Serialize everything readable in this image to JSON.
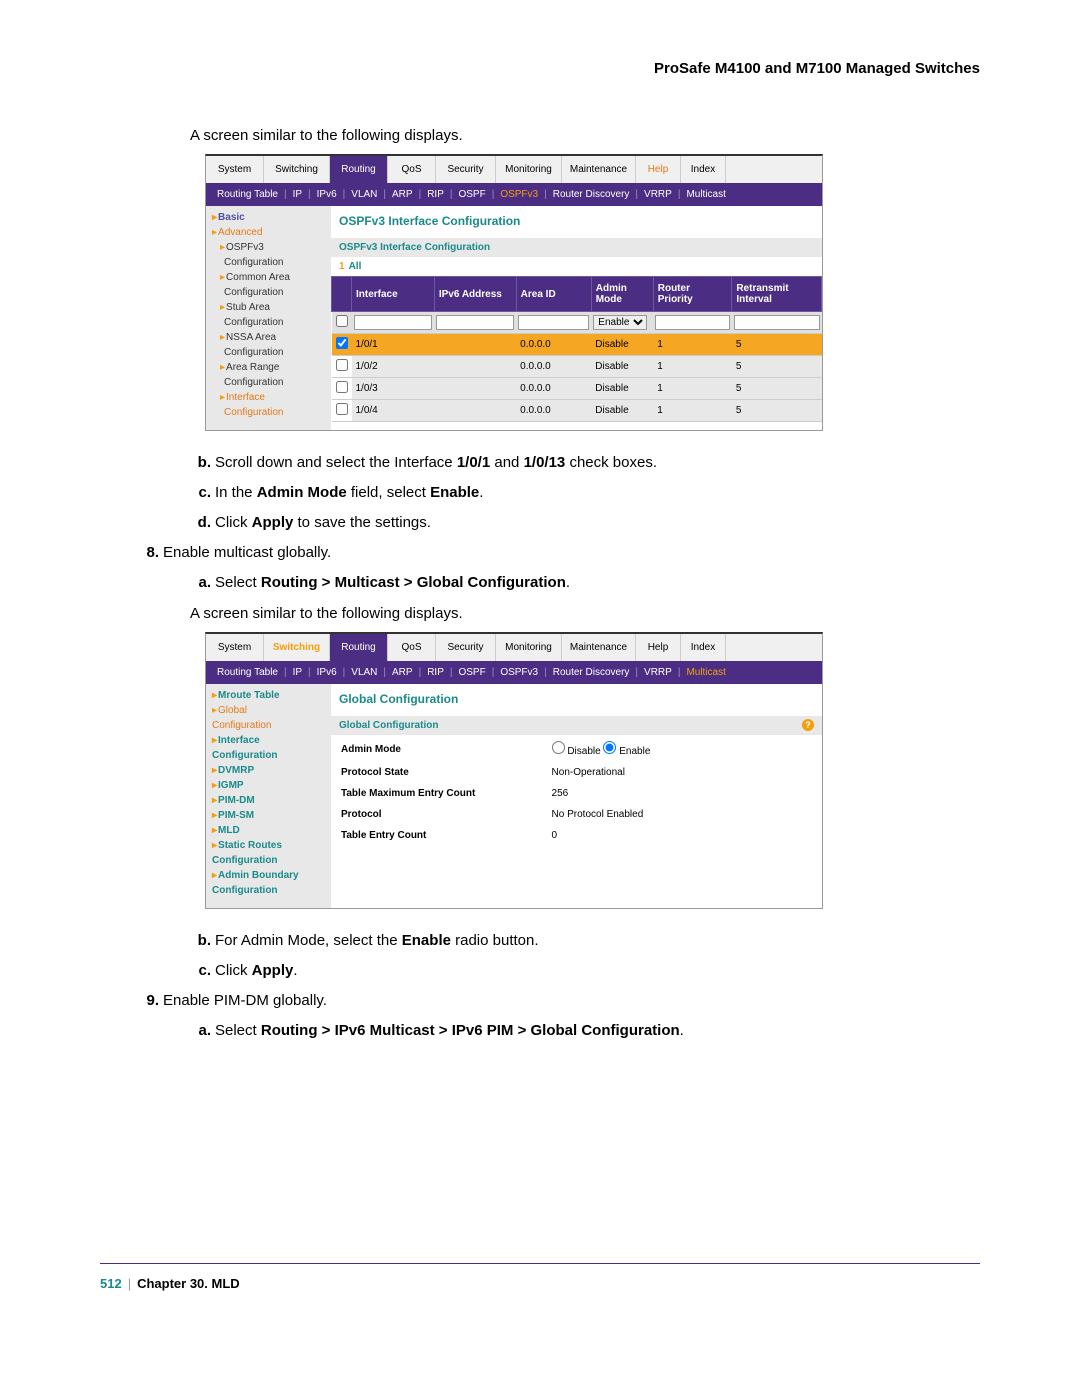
{
  "header": {
    "title": "ProSafe M4100 and M7100 Managed Switches"
  },
  "intro1": "A screen similar to the following displays.",
  "screenshot1": {
    "tabs": [
      "System",
      "Switching",
      "Routing",
      "QoS",
      "Security",
      "Monitoring",
      "Maintenance",
      "Help",
      "Index"
    ],
    "active_tab": 2,
    "help_orange": 7,
    "subnav": [
      "Routing Table",
      "IP",
      "IPv6",
      "VLAN",
      "ARP",
      "RIP",
      "OSPF",
      "OSPFv3",
      "Router Discovery",
      "VRRP",
      "Multicast"
    ],
    "subnav_active": 7,
    "sidebar": [
      {
        "text": "Basic",
        "cls": "blue",
        "caret": true,
        "sub": 0
      },
      {
        "text": "Advanced",
        "cls": "orange",
        "caret": true,
        "sub": 0
      },
      {
        "text": "OSPFv3",
        "cls": "",
        "caret": true,
        "sub": 1
      },
      {
        "text": "Configuration",
        "cls": "",
        "caret": false,
        "sub": 2
      },
      {
        "text": "Common Area",
        "cls": "",
        "caret": true,
        "sub": 1
      },
      {
        "text": "Configuration",
        "cls": "",
        "caret": false,
        "sub": 2
      },
      {
        "text": "Stub Area",
        "cls": "",
        "caret": true,
        "sub": 1
      },
      {
        "text": "Configuration",
        "cls": "",
        "caret": false,
        "sub": 2
      },
      {
        "text": "NSSA Area",
        "cls": "",
        "caret": true,
        "sub": 1
      },
      {
        "text": "Configuration",
        "cls": "",
        "caret": false,
        "sub": 2
      },
      {
        "text": "Area Range",
        "cls": "",
        "caret": true,
        "sub": 1
      },
      {
        "text": "Configuration",
        "cls": "",
        "caret": false,
        "sub": 2
      },
      {
        "text": "Interface",
        "cls": "orange",
        "caret": true,
        "sub": 1
      },
      {
        "text": "Configuration",
        "cls": "orange",
        "caret": false,
        "sub": 2
      }
    ],
    "content_title": "OSPFv3 Interface Configuration",
    "section_header": "OSPFv3 Interface Configuration",
    "all_label": "All",
    "columns": [
      "",
      "Interface",
      "IPv6 Address",
      "Area ID",
      "Admin Mode",
      "Router Priority",
      "Retransmit Interval"
    ],
    "input_select": "Enable",
    "rows": [
      {
        "chk": true,
        "iface": "1/0/1",
        "ipv6": "",
        "area": "0.0.0.0",
        "mode": "Disable",
        "prio": "1",
        "retx": "5",
        "orange": true
      },
      {
        "chk": false,
        "iface": "1/0/2",
        "ipv6": "",
        "area": "0.0.0.0",
        "mode": "Disable",
        "prio": "1",
        "retx": "5",
        "orange": false
      },
      {
        "chk": false,
        "iface": "1/0/3",
        "ipv6": "",
        "area": "0.0.0.0",
        "mode": "Disable",
        "prio": "1",
        "retx": "5",
        "orange": false
      },
      {
        "chk": false,
        "iface": "1/0/4",
        "ipv6": "",
        "area": "0.0.0.0",
        "mode": "Disable",
        "prio": "1",
        "retx": "5",
        "orange": false
      }
    ]
  },
  "instr1": {
    "b_lbl": "b.",
    "b_txt": "Scroll down and select the Interface ",
    "b_b1": "1/0/1",
    "b_mid": " and ",
    "b_b2": "1/0/13",
    "b_end": " check boxes.",
    "c_lbl": "c.",
    "c_pre": "In the ",
    "c_b1": "Admin Mode",
    "c_mid": " field, select ",
    "c_b2": "Enable",
    "c_end": ".",
    "d_lbl": "d.",
    "d_pre": "Click ",
    "d_b": "Apply",
    "d_end": " to save the settings.",
    "n8_lbl": "8.",
    "n8_txt": "Enable multicast globally.",
    "a_lbl": "a.",
    "a_pre": "Select ",
    "a_b": "Routing > Multicast > Global Configuration",
    "a_end": "."
  },
  "intro2": "A screen similar to the following displays.",
  "screenshot2": {
    "tabs": [
      "System",
      "Switching",
      "Routing",
      "QoS",
      "Security",
      "Monitoring",
      "Maintenance",
      "Help",
      "Index"
    ],
    "active_tab": 2,
    "switching_orange": 1,
    "subnav": [
      "Routing Table",
      "IP",
      "IPv6",
      "VLAN",
      "ARP",
      "RIP",
      "OSPF",
      "OSPFv3",
      "Router Discovery",
      "VRRP",
      "Multicast"
    ],
    "subnav_active": 10,
    "sidebar": [
      {
        "text": "Mroute Table",
        "cls": "teal",
        "caret": true
      },
      {
        "text": "Global",
        "cls": "orange",
        "caret": true
      },
      {
        "text": "Configuration",
        "cls": "orange",
        "caret": false
      },
      {
        "text": "Interface",
        "cls": "teal",
        "caret": true
      },
      {
        "text": "Configuration",
        "cls": "teal",
        "caret": false
      },
      {
        "text": "DVMRP",
        "cls": "teal",
        "caret": true
      },
      {
        "text": "IGMP",
        "cls": "teal",
        "caret": true
      },
      {
        "text": "PIM-DM",
        "cls": "teal",
        "caret": true
      },
      {
        "text": "PIM-SM",
        "cls": "teal",
        "caret": true
      },
      {
        "text": "MLD",
        "cls": "teal",
        "caret": true
      },
      {
        "text": "Static Routes",
        "cls": "teal",
        "caret": true
      },
      {
        "text": "Configuration",
        "cls": "teal",
        "caret": false
      },
      {
        "text": "Admin Boundary",
        "cls": "teal",
        "caret": true
      },
      {
        "text": "Configuration",
        "cls": "teal",
        "caret": false
      }
    ],
    "content_title": "Global Configuration",
    "section_header": "Global Configuration",
    "rows": [
      {
        "k": "Admin Mode",
        "type": "radio",
        "d": "Disable",
        "e": "Enable"
      },
      {
        "k": "Protocol State",
        "v": "Non-Operational"
      },
      {
        "k": "Table Maximum Entry Count",
        "v": "256"
      },
      {
        "k": "Protocol",
        "v": "No Protocol Enabled"
      },
      {
        "k": "Table Entry Count",
        "v": "0"
      }
    ]
  },
  "instr2": {
    "b_lbl": "b.",
    "b_pre": "For Admin Mode, select the ",
    "b_b": "Enable",
    "b_end": " radio button.",
    "c_lbl": "c.",
    "c_pre": "Click ",
    "c_b": "Apply",
    "c_end": ".",
    "n9_lbl": "9.",
    "n9_txt": "Enable PIM-DM globally.",
    "a_lbl": "a.",
    "a_pre": "Select ",
    "a_b": "Routing > IPv6 Multicast > IPv6 PIM > Global Configuration",
    "a_end": "."
  },
  "footer": {
    "page": "512",
    "chapter": "Chapter 30.  MLD"
  }
}
